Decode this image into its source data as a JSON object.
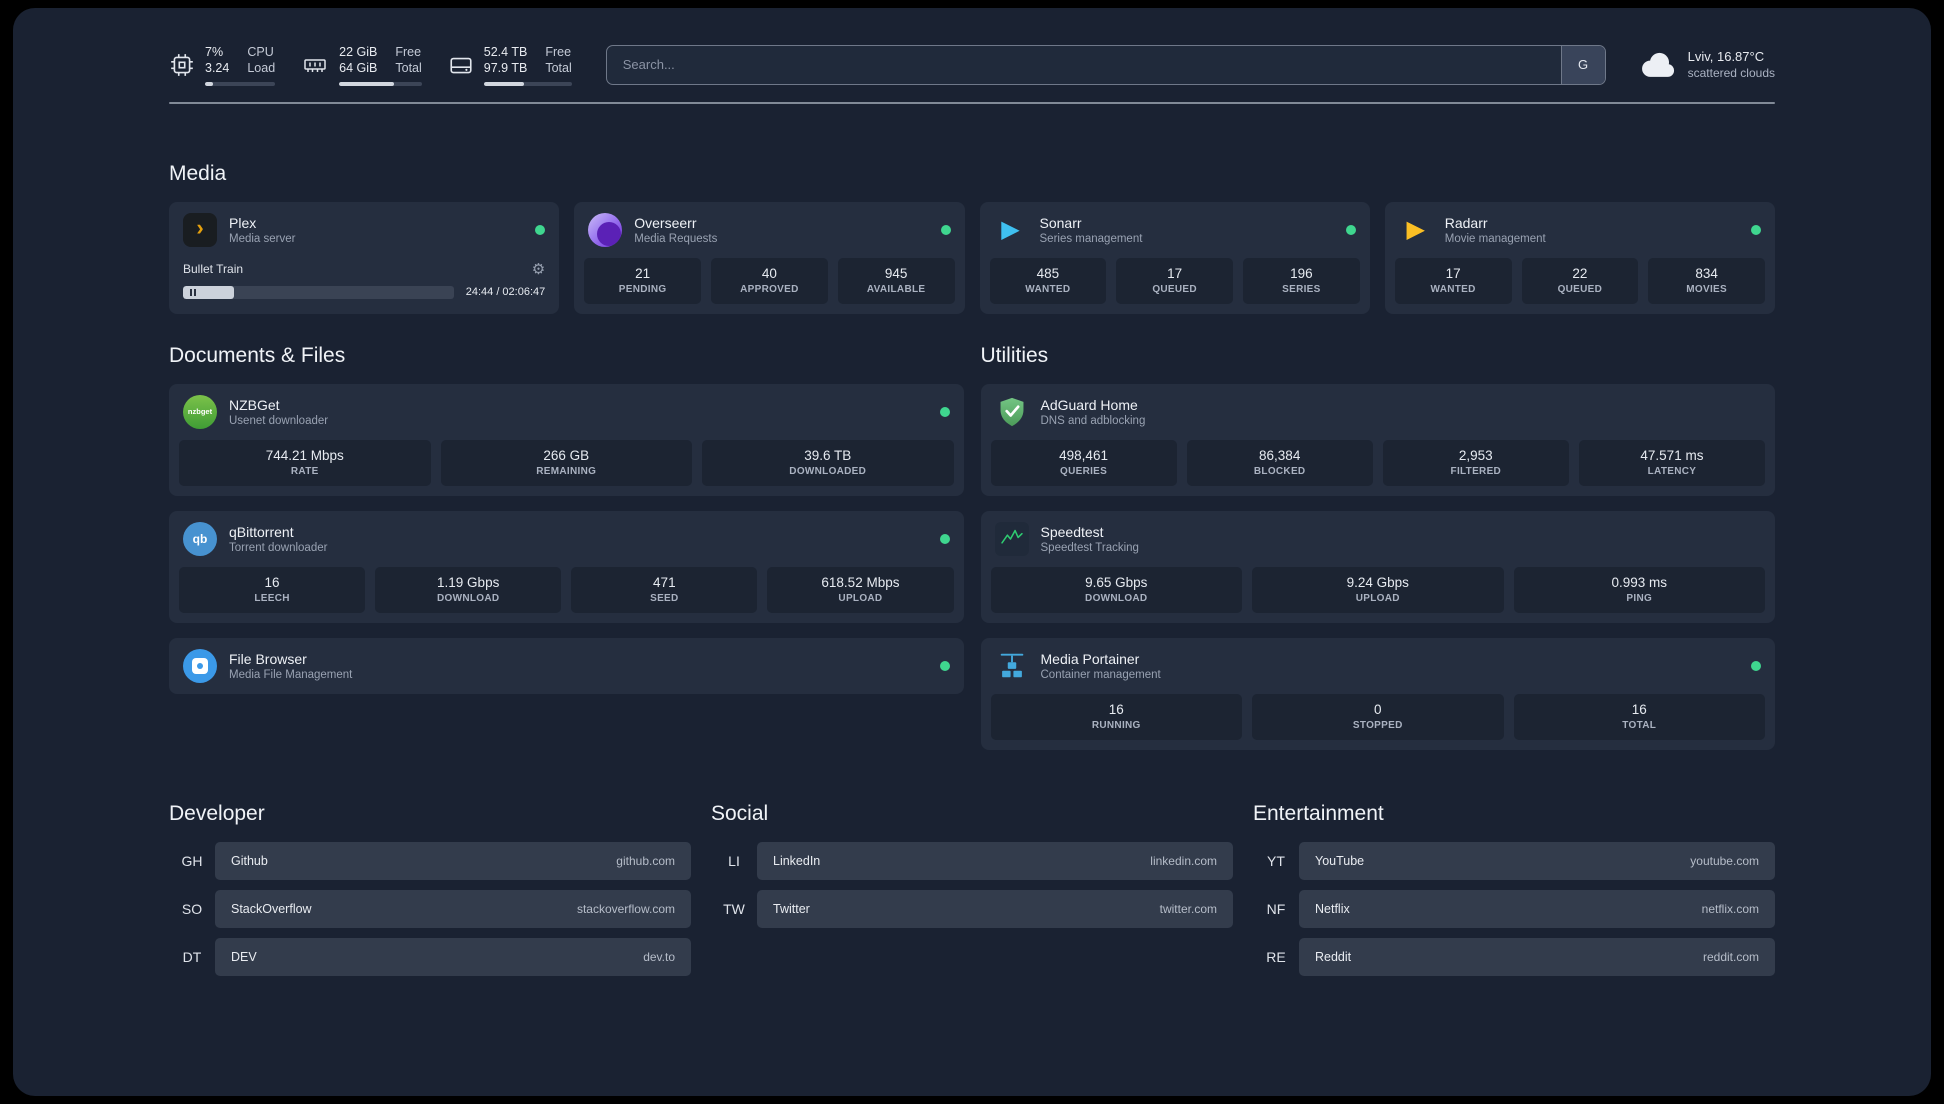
{
  "topbar": {
    "cpu": {
      "percent": "7%",
      "load": "3.24",
      "labels": [
        "CPU",
        "Load"
      ],
      "bar_percent": 12
    },
    "memory": {
      "free": "22 GiB",
      "total": "64 GiB",
      "labels": [
        "Free",
        "Total"
      ],
      "bar_percent": 66
    },
    "disk": {
      "free": "52.4 TB",
      "total": "97.9 TB",
      "labels": [
        "Free",
        "Total"
      ],
      "bar_percent": 46
    },
    "search": {
      "placeholder": "Search...",
      "provider_label": "G"
    },
    "weather": {
      "location": "Lviv, 16.87°C",
      "condition": "scattered clouds"
    }
  },
  "media": {
    "title": "Media",
    "plex": {
      "name": "Plex",
      "subtitle": "Media server",
      "icon_text": "›",
      "now_playing": {
        "title": "Bullet Train",
        "time": "24:44 / 02:06:47",
        "progress_percent": 19
      }
    },
    "overseerr": {
      "name": "Overseerr",
      "subtitle": "Media Requests",
      "stats": [
        {
          "value": "21",
          "label": "PENDING"
        },
        {
          "value": "40",
          "label": "APPROVED"
        },
        {
          "value": "945",
          "label": "AVAILABLE"
        }
      ]
    },
    "sonarr": {
      "name": "Sonarr",
      "subtitle": "Series management",
      "icon_text": "▶",
      "stats": [
        {
          "value": "485",
          "label": "WANTED"
        },
        {
          "value": "17",
          "label": "QUEUED"
        },
        {
          "value": "196",
          "label": "SERIES"
        }
      ]
    },
    "radarr": {
      "name": "Radarr",
      "subtitle": "Movie management",
      "icon_text": "▶",
      "stats": [
        {
          "value": "17",
          "label": "WANTED"
        },
        {
          "value": "22",
          "label": "QUEUED"
        },
        {
          "value": "834",
          "label": "MOVIES"
        }
      ]
    }
  },
  "documents": {
    "title": "Documents & Files",
    "nzbget": {
      "name": "NZBGet",
      "subtitle": "Usenet downloader",
      "icon_text": "nzbget",
      "stats": [
        {
          "value": "744.21 Mbps",
          "label": "RATE"
        },
        {
          "value": "266 GB",
          "label": "REMAINING"
        },
        {
          "value": "39.6 TB",
          "label": "DOWNLOADED"
        }
      ]
    },
    "qbittorrent": {
      "name": "qBittorrent",
      "subtitle": "Torrent downloader",
      "icon_text": "qb",
      "stats": [
        {
          "value": "16",
          "label": "LEECH"
        },
        {
          "value": "1.19 Gbps",
          "label": "DOWNLOAD"
        },
        {
          "value": "471",
          "label": "SEED"
        },
        {
          "value": "618.52 Mbps",
          "label": "UPLOAD"
        }
      ]
    },
    "filebrowser": {
      "name": "File Browser",
      "subtitle": "Media File Management"
    }
  },
  "utilities": {
    "title": "Utilities",
    "adguard": {
      "name": "AdGuard Home",
      "subtitle": "DNS and adblocking",
      "stats": [
        {
          "value": "498,461",
          "label": "QUERIES"
        },
        {
          "value": "86,384",
          "label": "BLOCKED"
        },
        {
          "value": "2,953",
          "label": "FILTERED"
        },
        {
          "value": "47.571 ms",
          "label": "LATENCY"
        }
      ]
    },
    "speedtest": {
      "name": "Speedtest",
      "subtitle": "Speedtest Tracking",
      "stats": [
        {
          "value": "9.65 Gbps",
          "label": "DOWNLOAD"
        },
        {
          "value": "9.24 Gbps",
          "label": "UPLOAD"
        },
        {
          "value": "0.993 ms",
          "label": "PING"
        }
      ]
    },
    "portainer": {
      "name": "Media Portainer",
      "subtitle": "Container management",
      "stats": [
        {
          "value": "16",
          "label": "RUNNING"
        },
        {
          "value": "0",
          "label": "STOPPED"
        },
        {
          "value": "16",
          "label": "TOTAL"
        }
      ]
    }
  },
  "bookmarks": {
    "developer": {
      "title": "Developer",
      "items": [
        {
          "abbr": "GH",
          "name": "Github",
          "domain": "github.com"
        },
        {
          "abbr": "SO",
          "name": "StackOverflow",
          "domain": "stackoverflow.com"
        },
        {
          "abbr": "DT",
          "name": "DEV",
          "domain": "dev.to"
        }
      ]
    },
    "social": {
      "title": "Social",
      "items": [
        {
          "abbr": "LI",
          "name": "LinkedIn",
          "domain": "linkedin.com"
        },
        {
          "abbr": "TW",
          "name": "Twitter",
          "domain": "twitter.com"
        }
      ]
    },
    "entertainment": {
      "title": "Entertainment",
      "items": [
        {
          "abbr": "YT",
          "name": "YouTube",
          "domain": "youtube.com"
        },
        {
          "abbr": "NF",
          "name": "Netflix",
          "domain": "netflix.com"
        },
        {
          "abbr": "RE",
          "name": "Reddit",
          "domain": "reddit.com"
        }
      ]
    }
  }
}
